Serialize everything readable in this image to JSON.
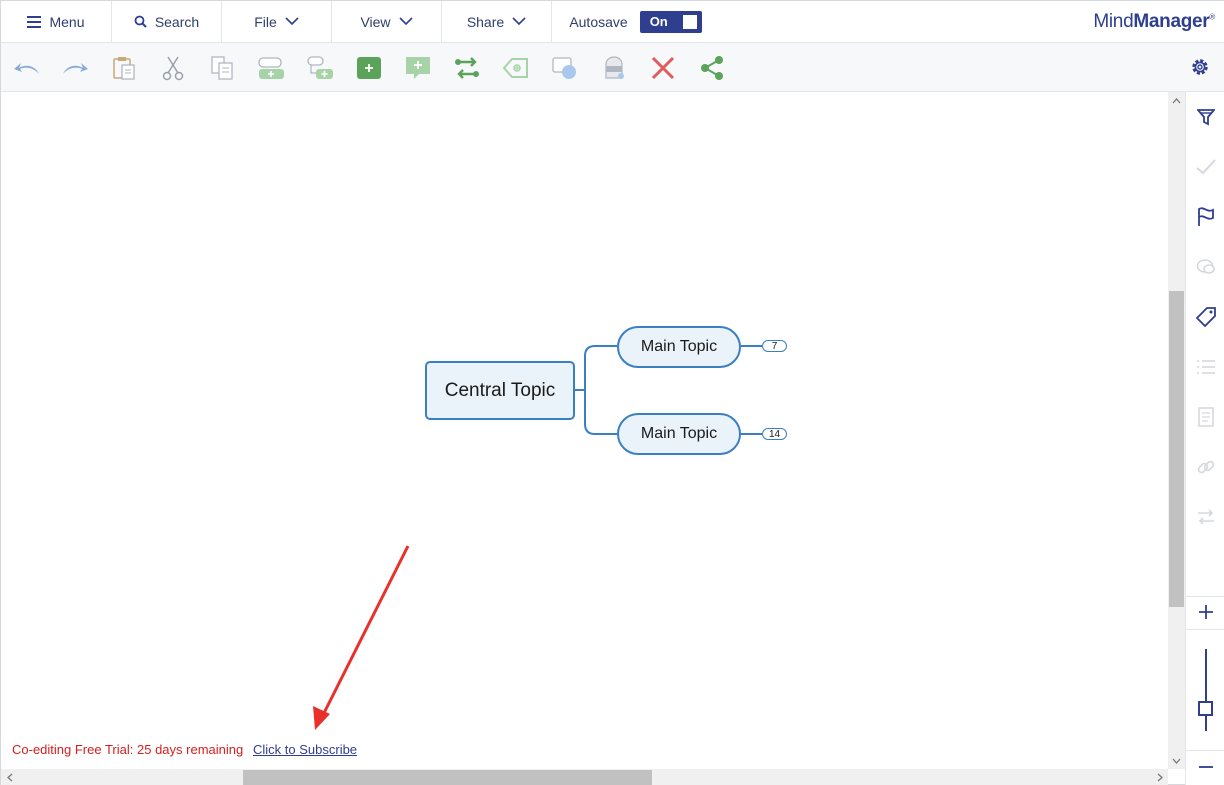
{
  "menubar": {
    "menu_label": "Menu",
    "search_label": "Search",
    "file_label": "File",
    "view_label": "View",
    "share_label": "Share",
    "autosave_label": "Autosave",
    "autosave_state": "On"
  },
  "brand": {
    "name_light": "Mind",
    "name_bold": "Manager",
    "mark": "®"
  },
  "toolbar": {
    "icons": [
      "undo-icon",
      "redo-icon",
      "paste-icon",
      "cut-icon",
      "copy-icon",
      "add-topic-icon",
      "add-subtopic-icon",
      "add-callout-icon",
      "add-callout-topic-icon",
      "add-relationship-icon",
      "add-boundary-icon",
      "shape-icon",
      "fill-color-icon",
      "delete-icon",
      "share-icon",
      "settings-icon"
    ]
  },
  "map": {
    "central_topic": "Central Topic",
    "main_topics": [
      {
        "label": "Main Topic",
        "count": "7"
      },
      {
        "label": "Main Topic",
        "count": "14"
      }
    ]
  },
  "footer": {
    "trial_text": "Co-editing Free Trial: 25 days remaining",
    "subscribe_link": "Click to Subscribe"
  },
  "colors": {
    "accent": "#2f3e8f",
    "topic_border": "#3a7fc1",
    "topic_fill": "#eaf2fa",
    "trial_red": "#d42020",
    "toolbar_green": "#5ba35b"
  }
}
